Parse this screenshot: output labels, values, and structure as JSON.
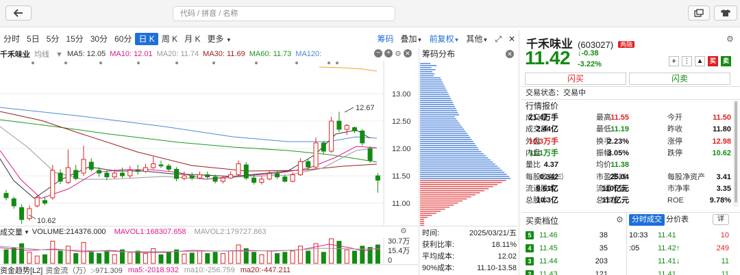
{
  "search": {
    "placeholder": "代码 / 拼音 / 名称"
  },
  "toolbar": {
    "periods": [
      "分时",
      "5日",
      "5分",
      "15分",
      "30分",
      "60分",
      "日 K",
      "周 K",
      "月 K",
      "更多"
    ],
    "active": "日 K",
    "right": [
      "筹码",
      "叠加",
      "前复权",
      "其他"
    ]
  },
  "legend": {
    "name": "千禾味业",
    "mode": "均线",
    "ma5": "MA5: 12.05",
    "ma10": "MA10: 12.01",
    "ma20": "MA20: 11.74",
    "ma30": "MA30: 11.69",
    "ma60": "MA60: 11.73",
    "ma120": "MA120:",
    "colors": {
      "ma5": "#333333",
      "ma10": "#e0198c",
      "ma20": "#999999",
      "ma30": "#9b1a1a",
      "ma60": "#1a9a1a",
      "ma120": "#4a8ad4"
    }
  },
  "price_axis": [
    "13.00",
    "12.50",
    "12.00",
    "11.50",
    "11.00"
  ],
  "annotations": {
    "high": "12.67",
    "low": "10.62"
  },
  "volume": {
    "label": "成交量",
    "volume": "VOLUME:214376.000",
    "mavol1": "MAVOL1:168307.658",
    "mavol2": "MAVOL2:179727.863",
    "axis": [
      "30.7万",
      "15.4万",
      "0"
    ]
  },
  "capital": {
    "label": "资金趋势[L2]",
    "flow": "资金流（万）:-971.309",
    "ma5": "ma5:-2018.932",
    "ma10": "ma10:-256.759",
    "ma20": "ma20:-447.211"
  },
  "chip": {
    "title": "筹码分布",
    "rows": [
      {
        "k": "时间:",
        "v": "2025/03/21/五"
      },
      {
        "k": "获利比率:",
        "v": "18.11%"
      },
      {
        "k": "平均成本:",
        "v": "12.02"
      },
      {
        "k": "90%成本:",
        "v": "11.10-13.58"
      }
    ]
  },
  "stock": {
    "name": "千禾味业",
    "code": "(603027)",
    "tag": "两融",
    "price": "11.42",
    "change": "-0.38",
    "pct": "-3.22%",
    "flash_buy": "闪买",
    "flash_sell": "闪卖",
    "status": "交易状态：交易中",
    "quote_title": "行情报价"
  },
  "quote": [
    [
      "成交量",
      "21.4万手",
      "最高",
      "11.55",
      "今开",
      "11.50"
    ],
    [
      "成交额",
      "2.44亿",
      "最低",
      "11.19",
      "昨收",
      "11.80"
    ],
    [
      "外盘",
      "10.3万手",
      "换手",
      "2.23%",
      "涨停",
      "12.98"
    ],
    [
      "内盘",
      "11.1万手",
      "振幅",
      "3.05%",
      "跌停",
      "10.62"
    ],
    [
      "量比",
      "4.37",
      "均价",
      "11.38",
      "",
      ""
    ],
    [
      "每股收益㈢",
      "0.342",
      "市盈率㈣",
      "25.04",
      "每股净资产",
      "3.41"
    ],
    [
      "流通股本",
      "9.61亿",
      "流通市值",
      "110亿元",
      "市净率",
      "3.35"
    ],
    [
      "总股本",
      "10.3亿",
      "总市值",
      "117亿元",
      "ROE",
      "9.78%"
    ]
  ],
  "book": {
    "title": "买卖档位",
    "tabs": [
      "分时成交",
      "分价表"
    ],
    "detail": "详",
    "bids": [
      [
        "5",
        "11.46",
        "38"
      ],
      [
        "4",
        "11.45",
        "35"
      ],
      [
        "3",
        "11.44",
        "203"
      ],
      [
        "2",
        "11.43",
        "121"
      ]
    ],
    "trades": [
      [
        "10:33",
        "11.41",
        "10"
      ],
      [
        ":05",
        "11.42↑",
        "249"
      ],
      [
        "",
        "11.41↓",
        "11"
      ],
      [
        "",
        "11.41",
        "11"
      ]
    ]
  }
}
